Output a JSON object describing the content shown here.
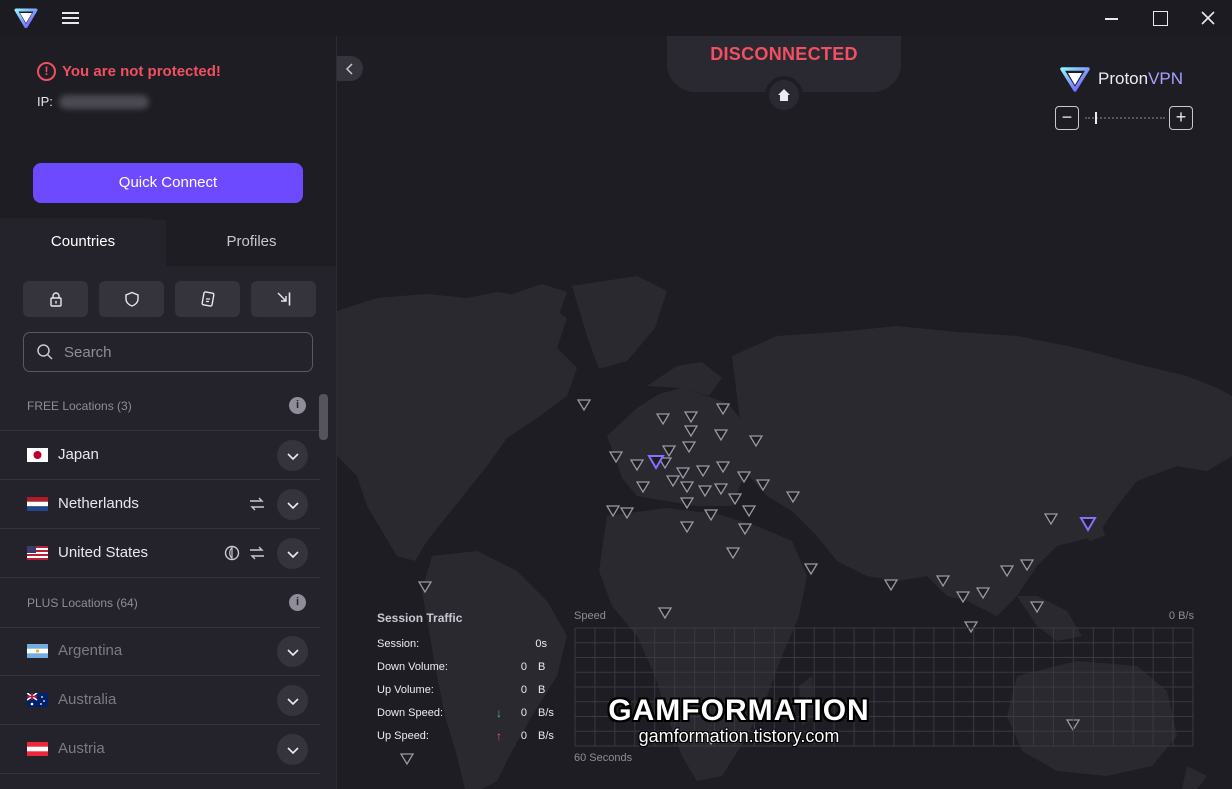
{
  "window": {
    "menu_icon": "hamburger-icon",
    "controls": [
      "minimize-icon",
      "maximize-icon",
      "close-icon"
    ]
  },
  "sidebar": {
    "warning": "You are not protected!",
    "ip_label": "IP:",
    "quick_connect": "Quick Connect",
    "tabs": [
      {
        "label": "Countries",
        "active": true
      },
      {
        "label": "Profiles",
        "active": false
      }
    ],
    "filters": [
      "secure-core-lock-icon",
      "shield-icon",
      "p2p-card-icon",
      "tor-exit-icon"
    ],
    "search_placeholder": "Search",
    "sections": [
      {
        "label": "FREE Locations (3)"
      },
      {
        "label": "PLUS Locations (64)"
      }
    ],
    "free_countries": [
      {
        "name": "Japan",
        "features": []
      },
      {
        "name": "Netherlands",
        "features": [
          "p2p-icon"
        ]
      },
      {
        "name": "United States",
        "features": [
          "tor-icon",
          "p2p-icon"
        ]
      }
    ],
    "plus_countries": [
      {
        "name": "Argentina"
      },
      {
        "name": "Australia"
      },
      {
        "name": "Austria"
      }
    ]
  },
  "map": {
    "status": "DISCONNECTED",
    "brand": {
      "proton": "Proton",
      "vpn": "VPN"
    },
    "zoom": {
      "out": "−",
      "in": "+"
    },
    "session_traffic": {
      "title": "Session Traffic",
      "rows": [
        {
          "label": "Session:",
          "value": "0s",
          "unit": ""
        },
        {
          "label": "Down Volume:",
          "value": "0",
          "unit": "B"
        },
        {
          "label": "Up Volume:",
          "value": "0",
          "unit": "B"
        },
        {
          "label": "Down Speed:",
          "value": "0",
          "unit": "B/s",
          "arrow": "↓"
        },
        {
          "label": "Up Speed:",
          "value": "0",
          "unit": "B/s",
          "arrow": "↑"
        }
      ]
    },
    "speed_graph": {
      "label": "Speed",
      "value": "0 B/s",
      "footer": "60 Seconds"
    }
  },
  "colors": {
    "accent": "#6d4aff",
    "danger": "#f05061",
    "sidebar": "#24232b",
    "map_bg": "#1e1d24",
    "land": "#2a2930"
  },
  "watermark": {
    "title": "GAMFORMATION",
    "url": "gamformation.tistory.com"
  }
}
